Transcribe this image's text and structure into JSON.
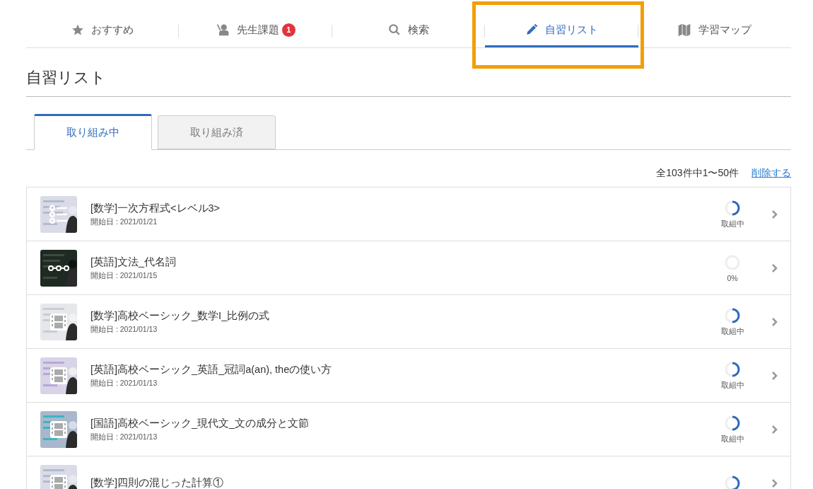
{
  "nav_tabs": [
    {
      "label": "おすすめ",
      "selected": false,
      "highlighted": false
    },
    {
      "label": "先生課題",
      "selected": false,
      "highlighted": false,
      "badge": "1"
    },
    {
      "label": "検索",
      "selected": false,
      "highlighted": false
    },
    {
      "label": "自習リスト",
      "selected": true,
      "highlighted": true
    },
    {
      "label": "学習マップ",
      "selected": false,
      "highlighted": false
    }
  ],
  "page_title": "自習リスト",
  "sub_tabs": [
    {
      "label": "取り組み中",
      "selected": true
    },
    {
      "label": "取り組み済",
      "selected": false
    }
  ],
  "count_text": "全103件中1〜50件",
  "delete_link": "削除する",
  "items": [
    {
      "title": "[数学]一次方程式<レベル3>",
      "start_date": "開始日 : 2021/01/21",
      "kind": "list",
      "level": 0.5,
      "status": "取組中"
    },
    {
      "title": "[英語]文法_代名詞",
      "start_date": "開始日 : 2021/01/15",
      "kind": "steps",
      "level": 0,
      "status": "0%"
    },
    {
      "title": "[数学]高校ベーシック_数学I_比例の式",
      "start_date": "開始日 : 2021/01/13",
      "kind": "video",
      "level": 0.5,
      "status": "取組中"
    },
    {
      "title": "[英語]高校ベーシック_英語_冠詞a(an), theの使い方",
      "start_date": "開始日 : 2021/01/13",
      "kind": "video",
      "level": 0.5,
      "status": "取組中"
    },
    {
      "title": "[国語]高校ベーシック_現代文_文の成分と文節",
      "start_date": "開始日 : 2021/01/13",
      "kind": "video",
      "level": 0.5,
      "status": "取組中"
    },
    {
      "title": "[数学]四則の混じった計算①",
      "kind": "video",
      "level": 0.5
    }
  ]
}
